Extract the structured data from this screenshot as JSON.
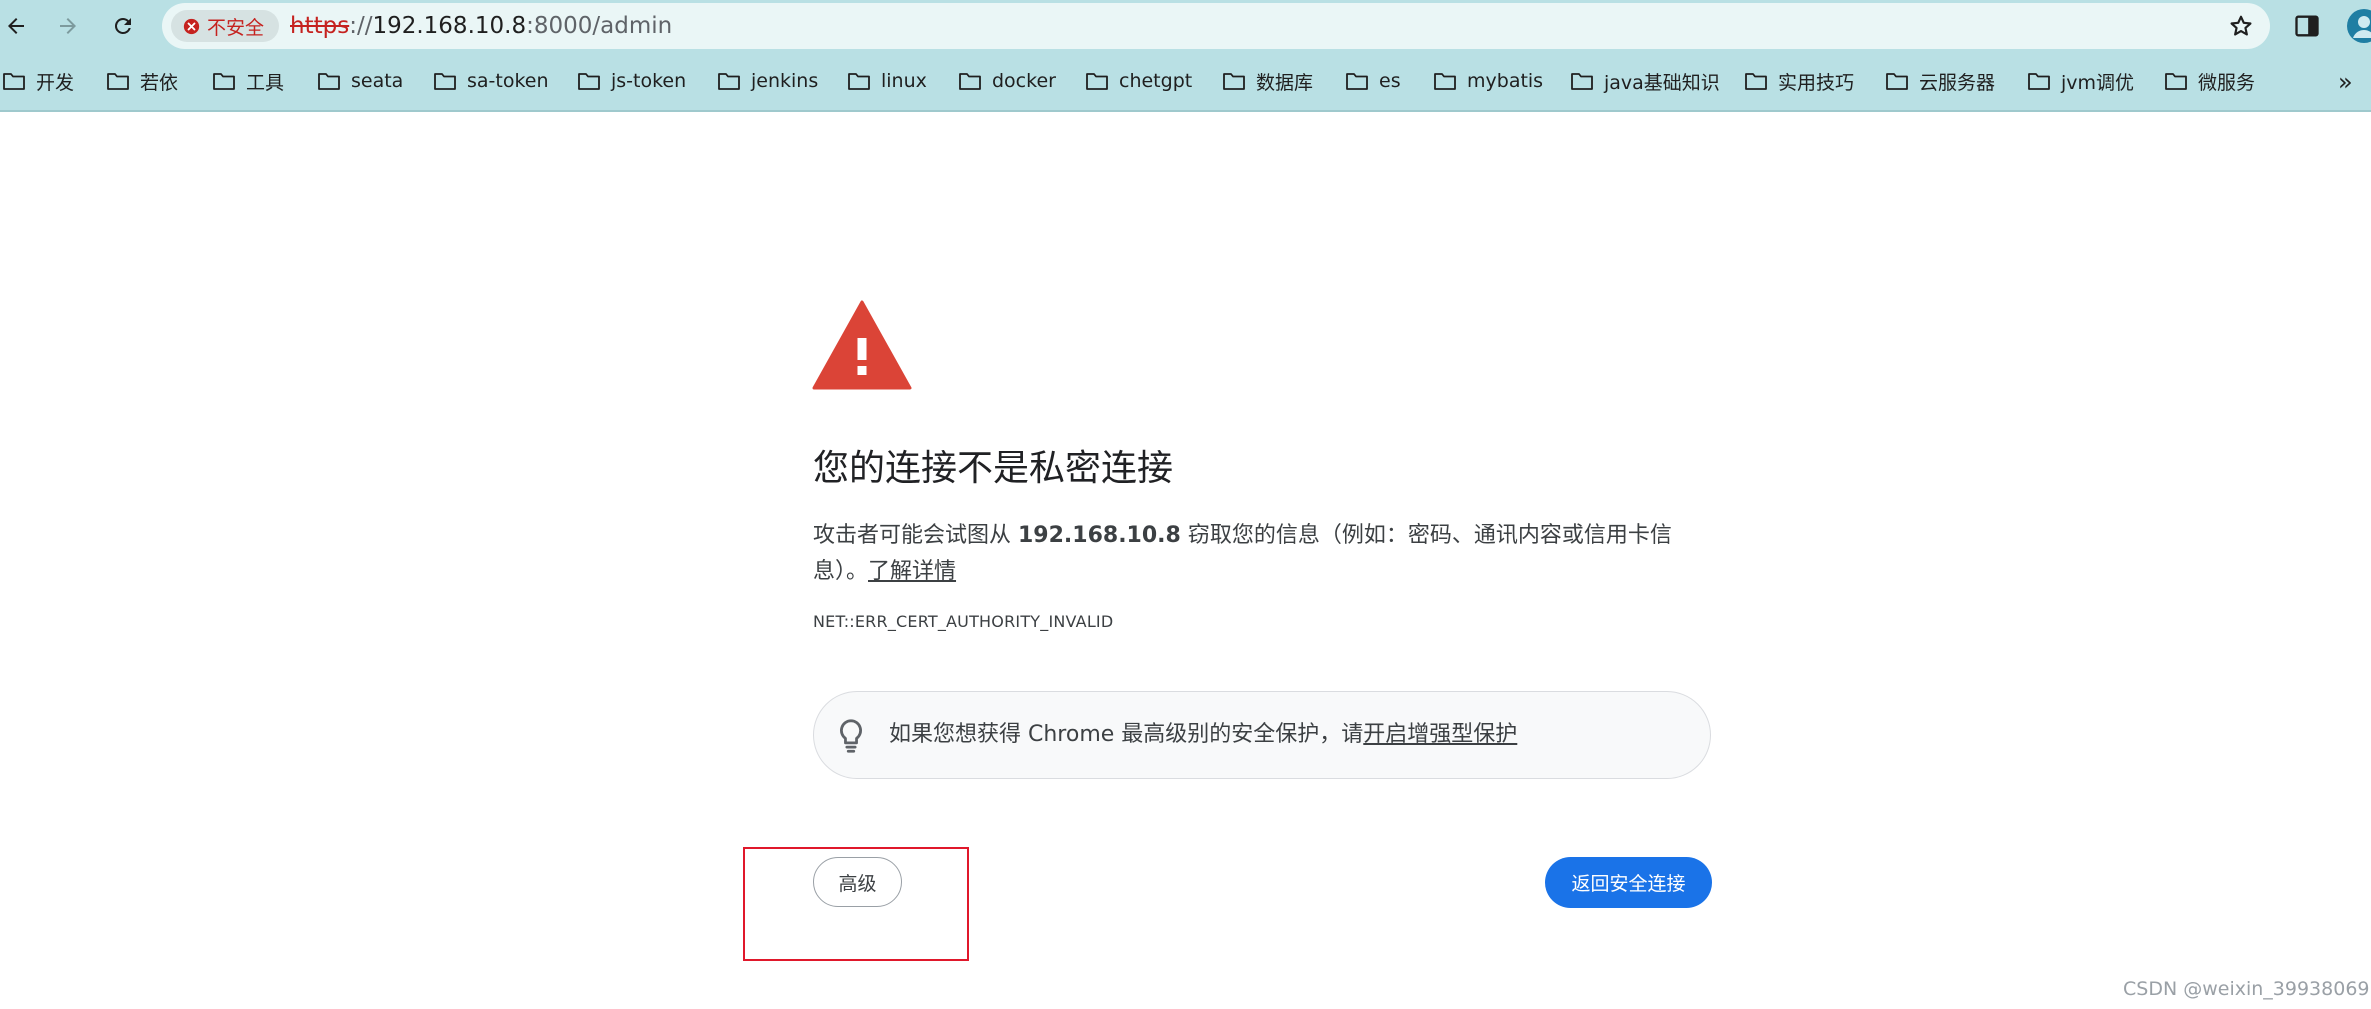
{
  "toolbar": {
    "back_icon": "arrow-left-icon",
    "forward_icon": "arrow-right-icon",
    "reload_icon": "reload-icon",
    "security_chip": "不安全",
    "url_scheme": "https",
    "url_separator": "://",
    "url_host": "192.168.10.8",
    "url_path": ":8000/admin",
    "star_icon": "star-icon",
    "side_panel_icon": "side-panel-icon",
    "profile_icon": "profile-icon"
  },
  "bookmarks": {
    "items": [
      {
        "label": "开发"
      },
      {
        "label": "若依"
      },
      {
        "label": "工具"
      },
      {
        "label": "seata"
      },
      {
        "label": "sa-token"
      },
      {
        "label": "js-token"
      },
      {
        "label": "jenkins"
      },
      {
        "label": "linux"
      },
      {
        "label": "docker"
      },
      {
        "label": "chetgpt"
      },
      {
        "label": "数据库"
      },
      {
        "label": "es"
      },
      {
        "label": "mybatis"
      },
      {
        "label": "java基础知识"
      },
      {
        "label": "实用技巧"
      },
      {
        "label": "云服务器"
      },
      {
        "label": "jvm调优"
      },
      {
        "label": "微服务"
      }
    ],
    "more": "»"
  },
  "interstitial": {
    "heading": "您的连接不是私密连接",
    "body_prefix": "攻击者可能会试图从 ",
    "body_host": "192.168.10.8",
    "body_suffix": " 窃取您的信息（例如：密码、通讯内容或信用卡信息）。",
    "learn_more": "了解详情",
    "error_code": "NET::ERR_CERT_AUTHORITY_INVALID",
    "promo_text": "如果您想获得 Chrome 最高级别的安全保护，请",
    "promo_link": "开启增强型保护",
    "advanced_button": "高级",
    "back_button": "返回安全连接"
  },
  "watermark": "CSDN @weixin_39938069",
  "colors": {
    "toolbar_bg": "#b9e0e4",
    "warning_red": "#db4437",
    "primary_blue": "#1a73e8",
    "annotation_red": "#e0182b"
  }
}
